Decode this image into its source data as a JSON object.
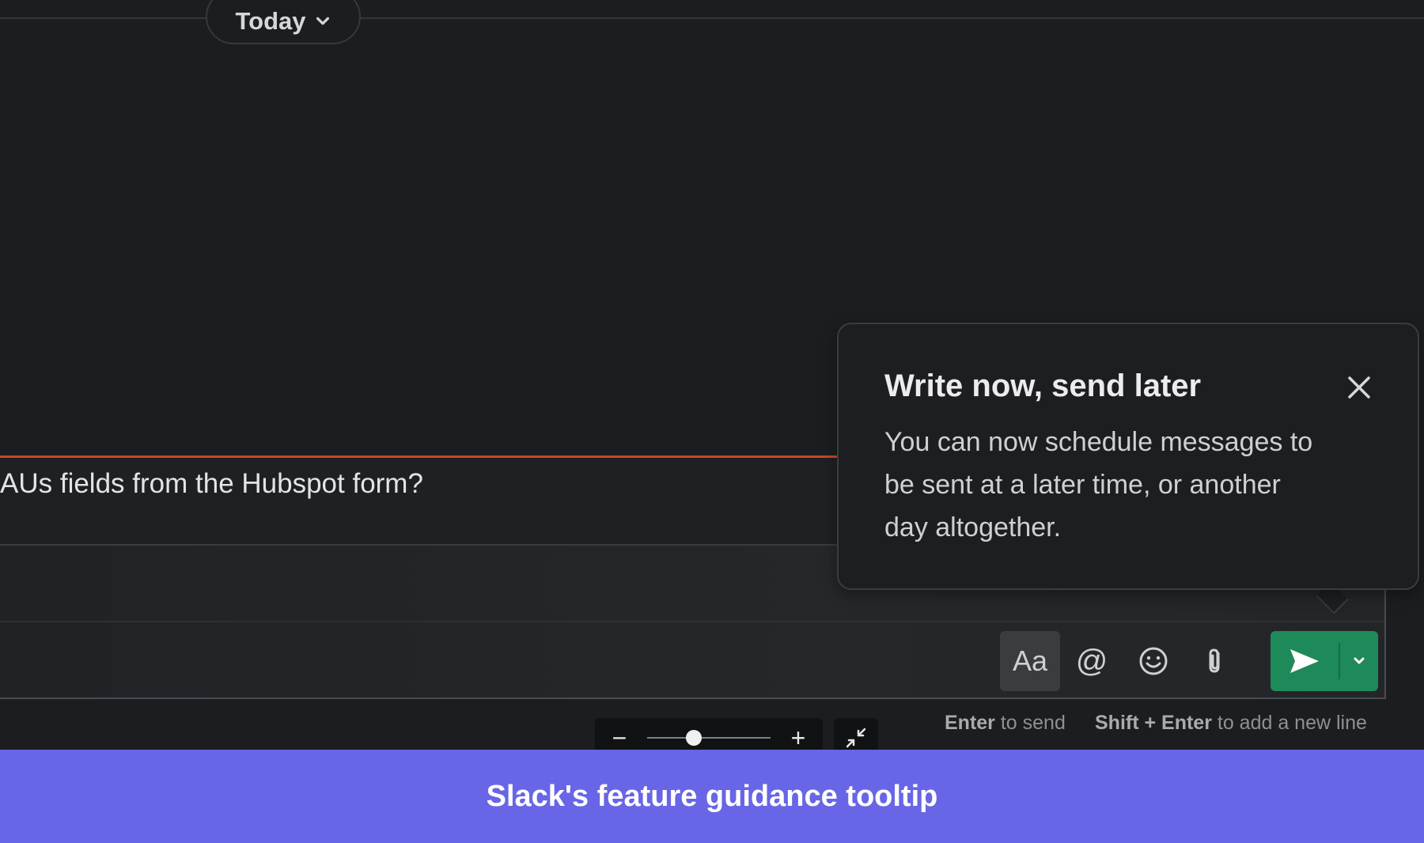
{
  "header": {
    "date_label": "Today"
  },
  "message": {
    "text": "AUs fields from the Hubspot form?"
  },
  "composer": {
    "formatting_label": "Aa",
    "mention_label": "@",
    "icons": {
      "emoji": "emoji-icon",
      "attach": "paperclip-icon",
      "send": "send-icon",
      "send_options": "chevron-down-icon"
    },
    "send_color": "#1f8a59"
  },
  "hints": {
    "send_key": "Enter",
    "send_text": " to send",
    "newline_key": "Shift + Enter",
    "newline_text": " to add a new line"
  },
  "zoom": {
    "minus": "−",
    "plus": "+",
    "level": 0.38
  },
  "tooltip": {
    "title": "Write now, send later",
    "body": "You can now schedule messages to be sent at a later time, or another day altogether."
  },
  "caption": {
    "text": "Slack's feature guidance tooltip",
    "color": "#6866e6"
  },
  "colors": {
    "new_message_line": "#c24a24",
    "background": "#1c1d20"
  }
}
